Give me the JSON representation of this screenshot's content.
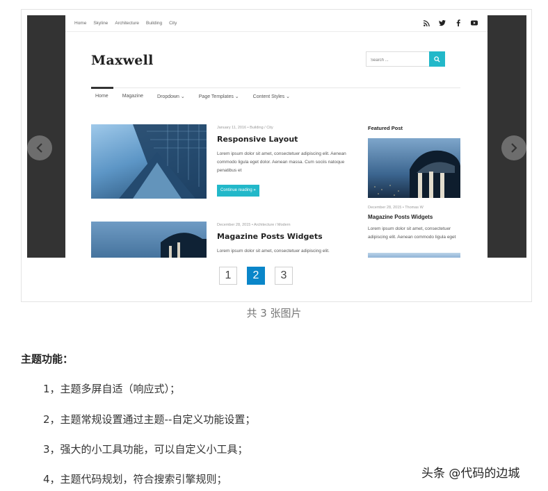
{
  "site": {
    "top_nav": [
      "Home",
      "Skyline",
      "Architecture",
      "Building",
      "City"
    ],
    "social_icons": [
      "rss-icon",
      "twitter-icon",
      "facebook-icon",
      "youtube-icon"
    ],
    "logo": "Maxwell",
    "search_placeholder": "Search ...",
    "main_nav": [
      "Home",
      "Magazine",
      "Dropdown ⌄",
      "Page Templates ⌄",
      "Content Styles ⌄"
    ],
    "posts": [
      {
        "meta": "January 11, 2016  •  Building / City",
        "title": "Responsive Layout",
        "excerpt": "Lorem ipsum dolor sit amet, consectetuer adipiscing elit. Aenean commodo ligula eget dolor. Aenean massa. Cum sociis natoque penatibus et",
        "button": "Continue reading »"
      },
      {
        "meta": "December 28, 2015  •  Architecture / Modern",
        "title": "Magazine Posts Widgets",
        "excerpt": "Lorem ipsum dolor sit amet, consectetuer adipiscing elit."
      }
    ],
    "sidebar": {
      "title": "Featured Post",
      "meta": "December 28, 2015  •  Thomas W",
      "post_title": "Magazine Posts Widgets",
      "excerpt": "Lorem ipsum dolor sit amet, consectetuer adipiscing elit. Aenean commodo ligula eget"
    }
  },
  "pager": {
    "pages": [
      "1",
      "2",
      "3"
    ],
    "active_index": 1
  },
  "caption": "共 3 张图片",
  "article": {
    "heading": "主题功能：",
    "features": [
      "1，主题多屏自适（响应式）；",
      "2，主题常规设置通过主题--自定义功能设置；",
      "3，强大的小工具功能，可以自定义小工具；",
      "4，主题代码规划，符合搜索引擎规则；"
    ]
  },
  "watermark": "头条 @代码的边城",
  "colors": {
    "accent": "#22b8c9",
    "pager_active": "#0a86c9",
    "slide_bg": "#333333"
  }
}
